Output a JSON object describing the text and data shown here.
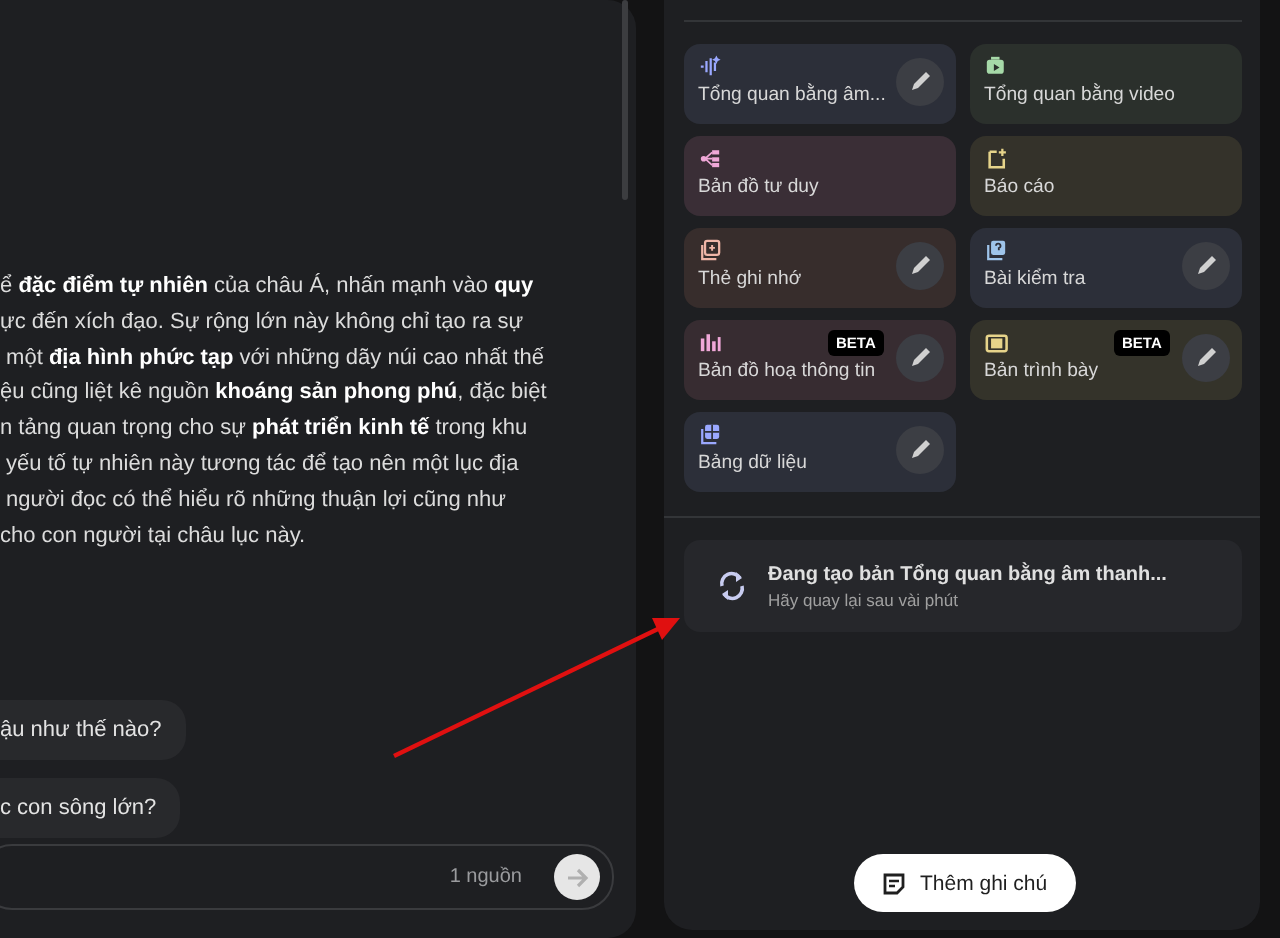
{
  "chat": {
    "response_lines": [
      "ể **đặc điểm tự nhiên** của châu Á, nhấn mạnh vào **quy**",
      "ực đến xích đạo. Sự rộng lớn này không chỉ tạo ra sự",
      " một **địa hình phức tạp** với những dãy núi cao nhất thế",
      "ệu cũng liệt kê nguồn **khoáng sản phong phú**, đặc biệt",
      "n tảng quan trọng cho sự **phát triển kinh tế** trong khu",
      " yếu tố tự nhiên này tương tác để tạo nên một lục địa",
      " người đọc có thể hiểu rõ những thuận lợi cũng như",
      "cho con người tại châu lục này."
    ],
    "suggestions": [
      "ậu như thế nào?",
      "c con sông lớn?"
    ],
    "source_count": "1 nguồn"
  },
  "studio": {
    "tiles": [
      {
        "kind": "audio",
        "label": "Tổng quan bằng âm...",
        "color": "#2c2f39",
        "edit": true
      },
      {
        "kind": "video",
        "label": "Tổng quan bằng video",
        "color": "#2b302c",
        "edit": false
      },
      {
        "kind": "mindmap",
        "label": "Bản đồ tư duy",
        "color": "#3a2e36",
        "edit": false
      },
      {
        "kind": "report",
        "label": "Báo cáo",
        "color": "#34322a",
        "edit": false
      },
      {
        "kind": "flashcard",
        "label": "Thẻ ghi nhớ",
        "color": "#372d2c",
        "edit": true
      },
      {
        "kind": "quiz",
        "label": "Bài kiểm tra",
        "color": "#2c2f39",
        "edit": true
      },
      {
        "kind": "infographic",
        "label": "Bản đồ hoạ thông tin",
        "color": "#372c31",
        "edit": true,
        "badge": "BETA"
      },
      {
        "kind": "slides",
        "label": "Bản trình bày",
        "color": "#34332a",
        "edit": true,
        "badge": "BETA"
      },
      {
        "kind": "table",
        "label": "Bảng dữ liệu",
        "color": "#2c2f39",
        "edit": true
      }
    ],
    "progress": {
      "title": "Đang tạo bản Tổng quan bằng âm thanh...",
      "subtitle": "Hãy quay lại sau vài phút"
    },
    "add_note_button": "Thêm ghi chú"
  }
}
